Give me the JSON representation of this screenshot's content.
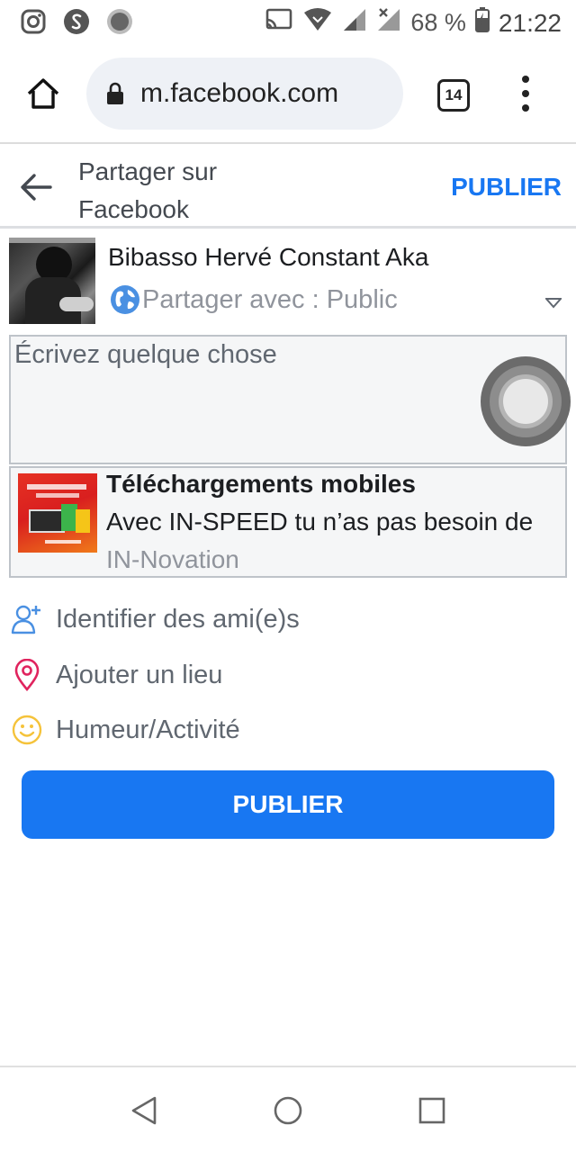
{
  "status_bar": {
    "left_icons": [
      "instagram-icon",
      "shazam-icon",
      "record-icon"
    ],
    "battery": "68 %",
    "time": "21:22"
  },
  "browser": {
    "url": "m.facebook.com",
    "tab_count": "14"
  },
  "header": {
    "title": "Partager sur Facebook",
    "publish": "PUBLIER"
  },
  "user": {
    "name": "Bibasso Hervé Constant Aka",
    "audience": "Partager avec :  Public"
  },
  "composer": {
    "placeholder": "Écrivez quelque chose"
  },
  "link_preview": {
    "title": "Téléchargements mobiles",
    "description": "Avec IN-SPEED tu n’as pas besoin de ",
    "domain": "IN-Novation"
  },
  "options": {
    "tag_friends": "Identifier des ami(e)s",
    "add_place": "Ajouter un lieu",
    "mood": "Humeur/Activité"
  },
  "publish_button": "PUBLIER",
  "colors": {
    "accent": "#1877f2",
    "tag_icon": "#4a90e2",
    "place_icon": "#e0245e",
    "mood_icon": "#f5c33b"
  }
}
